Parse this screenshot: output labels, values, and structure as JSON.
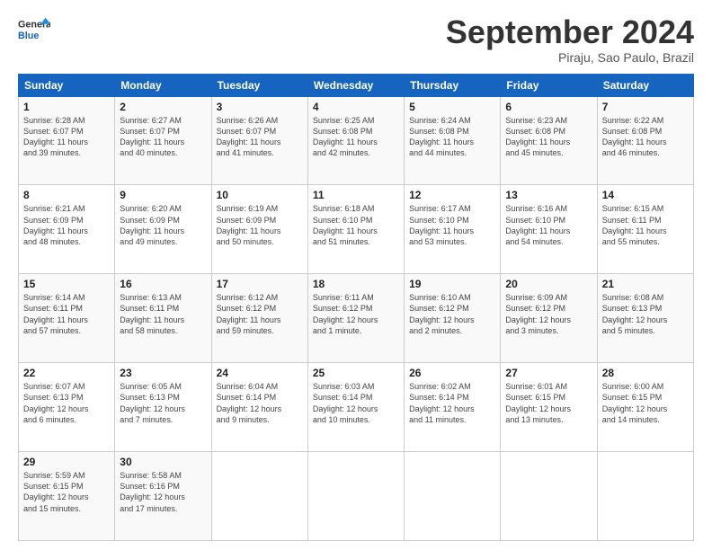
{
  "logo": {
    "line1": "General",
    "line2": "Blue"
  },
  "header": {
    "month": "September 2024",
    "location": "Piraju, Sao Paulo, Brazil"
  },
  "days_header": [
    "Sunday",
    "Monday",
    "Tuesday",
    "Wednesday",
    "Thursday",
    "Friday",
    "Saturday"
  ],
  "weeks": [
    [
      {
        "day": "1",
        "lines": [
          "Sunrise: 6:28 AM",
          "Sunset: 6:07 PM",
          "Daylight: 11 hours",
          "and 39 minutes."
        ]
      },
      {
        "day": "2",
        "lines": [
          "Sunrise: 6:27 AM",
          "Sunset: 6:07 PM",
          "Daylight: 11 hours",
          "and 40 minutes."
        ]
      },
      {
        "day": "3",
        "lines": [
          "Sunrise: 6:26 AM",
          "Sunset: 6:07 PM",
          "Daylight: 11 hours",
          "and 41 minutes."
        ]
      },
      {
        "day": "4",
        "lines": [
          "Sunrise: 6:25 AM",
          "Sunset: 6:08 PM",
          "Daylight: 11 hours",
          "and 42 minutes."
        ]
      },
      {
        "day": "5",
        "lines": [
          "Sunrise: 6:24 AM",
          "Sunset: 6:08 PM",
          "Daylight: 11 hours",
          "and 44 minutes."
        ]
      },
      {
        "day": "6",
        "lines": [
          "Sunrise: 6:23 AM",
          "Sunset: 6:08 PM",
          "Daylight: 11 hours",
          "and 45 minutes."
        ]
      },
      {
        "day": "7",
        "lines": [
          "Sunrise: 6:22 AM",
          "Sunset: 6:08 PM",
          "Daylight: 11 hours",
          "and 46 minutes."
        ]
      }
    ],
    [
      {
        "day": "8",
        "lines": [
          "Sunrise: 6:21 AM",
          "Sunset: 6:09 PM",
          "Daylight: 11 hours",
          "and 48 minutes."
        ]
      },
      {
        "day": "9",
        "lines": [
          "Sunrise: 6:20 AM",
          "Sunset: 6:09 PM",
          "Daylight: 11 hours",
          "and 49 minutes."
        ]
      },
      {
        "day": "10",
        "lines": [
          "Sunrise: 6:19 AM",
          "Sunset: 6:09 PM",
          "Daylight: 11 hours",
          "and 50 minutes."
        ]
      },
      {
        "day": "11",
        "lines": [
          "Sunrise: 6:18 AM",
          "Sunset: 6:10 PM",
          "Daylight: 11 hours",
          "and 51 minutes."
        ]
      },
      {
        "day": "12",
        "lines": [
          "Sunrise: 6:17 AM",
          "Sunset: 6:10 PM",
          "Daylight: 11 hours",
          "and 53 minutes."
        ]
      },
      {
        "day": "13",
        "lines": [
          "Sunrise: 6:16 AM",
          "Sunset: 6:10 PM",
          "Daylight: 11 hours",
          "and 54 minutes."
        ]
      },
      {
        "day": "14",
        "lines": [
          "Sunrise: 6:15 AM",
          "Sunset: 6:11 PM",
          "Daylight: 11 hours",
          "and 55 minutes."
        ]
      }
    ],
    [
      {
        "day": "15",
        "lines": [
          "Sunrise: 6:14 AM",
          "Sunset: 6:11 PM",
          "Daylight: 11 hours",
          "and 57 minutes."
        ]
      },
      {
        "day": "16",
        "lines": [
          "Sunrise: 6:13 AM",
          "Sunset: 6:11 PM",
          "Daylight: 11 hours",
          "and 58 minutes."
        ]
      },
      {
        "day": "17",
        "lines": [
          "Sunrise: 6:12 AM",
          "Sunset: 6:12 PM",
          "Daylight: 11 hours",
          "and 59 minutes."
        ]
      },
      {
        "day": "18",
        "lines": [
          "Sunrise: 6:11 AM",
          "Sunset: 6:12 PM",
          "Daylight: 12 hours",
          "and 1 minute."
        ]
      },
      {
        "day": "19",
        "lines": [
          "Sunrise: 6:10 AM",
          "Sunset: 6:12 PM",
          "Daylight: 12 hours",
          "and 2 minutes."
        ]
      },
      {
        "day": "20",
        "lines": [
          "Sunrise: 6:09 AM",
          "Sunset: 6:12 PM",
          "Daylight: 12 hours",
          "and 3 minutes."
        ]
      },
      {
        "day": "21",
        "lines": [
          "Sunrise: 6:08 AM",
          "Sunset: 6:13 PM",
          "Daylight: 12 hours",
          "and 5 minutes."
        ]
      }
    ],
    [
      {
        "day": "22",
        "lines": [
          "Sunrise: 6:07 AM",
          "Sunset: 6:13 PM",
          "Daylight: 12 hours",
          "and 6 minutes."
        ]
      },
      {
        "day": "23",
        "lines": [
          "Sunrise: 6:05 AM",
          "Sunset: 6:13 PM",
          "Daylight: 12 hours",
          "and 7 minutes."
        ]
      },
      {
        "day": "24",
        "lines": [
          "Sunrise: 6:04 AM",
          "Sunset: 6:14 PM",
          "Daylight: 12 hours",
          "and 9 minutes."
        ]
      },
      {
        "day": "25",
        "lines": [
          "Sunrise: 6:03 AM",
          "Sunset: 6:14 PM",
          "Daylight: 12 hours",
          "and 10 minutes."
        ]
      },
      {
        "day": "26",
        "lines": [
          "Sunrise: 6:02 AM",
          "Sunset: 6:14 PM",
          "Daylight: 12 hours",
          "and 11 minutes."
        ]
      },
      {
        "day": "27",
        "lines": [
          "Sunrise: 6:01 AM",
          "Sunset: 6:15 PM",
          "Daylight: 12 hours",
          "and 13 minutes."
        ]
      },
      {
        "day": "28",
        "lines": [
          "Sunrise: 6:00 AM",
          "Sunset: 6:15 PM",
          "Daylight: 12 hours",
          "and 14 minutes."
        ]
      }
    ],
    [
      {
        "day": "29",
        "lines": [
          "Sunrise: 5:59 AM",
          "Sunset: 6:15 PM",
          "Daylight: 12 hours",
          "and 15 minutes."
        ]
      },
      {
        "day": "30",
        "lines": [
          "Sunrise: 5:58 AM",
          "Sunset: 6:16 PM",
          "Daylight: 12 hours",
          "and 17 minutes."
        ]
      },
      {
        "day": "",
        "lines": []
      },
      {
        "day": "",
        "lines": []
      },
      {
        "day": "",
        "lines": []
      },
      {
        "day": "",
        "lines": []
      },
      {
        "day": "",
        "lines": []
      }
    ]
  ]
}
